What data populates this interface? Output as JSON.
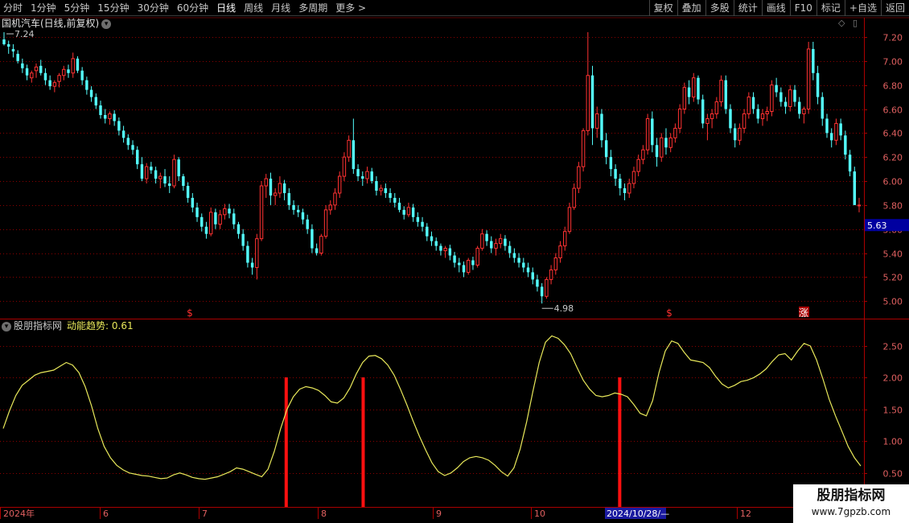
{
  "toolbar": {
    "periods": [
      "分时",
      "1分钟",
      "5分钟",
      "15分钟",
      "30分钟",
      "60分钟",
      "日线",
      "周线",
      "月线",
      "多周期",
      "更多 >"
    ],
    "active": "日线",
    "actions": [
      "复权",
      "叠加",
      "多股",
      "统计",
      "画线",
      "F10",
      "标记",
      "+自选",
      "返回"
    ]
  },
  "stock": {
    "title": "国机汽车(日线,前复权)",
    "high_label": "7.24",
    "low_label": "4.98",
    "last_price": "5.63"
  },
  "price_axis": [
    "7.20",
    "7.00",
    "6.80",
    "6.60",
    "6.40",
    "6.20",
    "6.00",
    "5.80",
    "5.60",
    "5.40",
    "5.20",
    "5.00"
  ],
  "indicator": {
    "name": "股朋指标网",
    "label": "动能趋势:",
    "value": "0.61"
  },
  "indicator_axis": [
    "2.50",
    "2.00",
    "1.50",
    "1.00",
    "0.50"
  ],
  "date_axis": [
    "2024年",
    "6",
    "7",
    "8",
    "9",
    "10",
    "2024/10/28/—",
    "12"
  ],
  "markers": [
    {
      "text": "$",
      "color": "#ff3030"
    },
    {
      "text": "$",
      "color": "#ff3030"
    },
    {
      "text": "涨",
      "color": "#ffffff"
    }
  ],
  "watermark": {
    "title": "股朋指标网",
    "url": "www.7gpzb.com"
  },
  "colors": {
    "up": "#ff3232",
    "down": "#54ffff",
    "line": "#e8e85a",
    "grid": "#8b0000",
    "signal": "#ff1010"
  },
  "chart_data": {
    "type": "candlestick",
    "candles": [
      [
        7.18,
        7.24,
        7.13,
        7.14
      ],
      [
        7.14,
        7.17,
        7.06,
        7.12
      ],
      [
        7.1,
        7.14,
        7.03,
        7.08
      ],
      [
        7.06,
        7.09,
        6.98,
        7.0
      ],
      [
        6.98,
        7.02,
        6.9,
        6.94
      ],
      [
        6.94,
        6.97,
        6.84,
        6.88
      ],
      [
        6.86,
        6.92,
        6.82,
        6.9
      ],
      [
        6.92,
        6.98,
        6.86,
        6.95
      ],
      [
        6.96,
        7.01,
        6.88,
        6.9
      ],
      [
        6.9,
        6.94,
        6.8,
        6.84
      ],
      [
        6.84,
        6.88,
        6.76,
        6.79
      ],
      [
        6.79,
        6.84,
        6.74,
        6.82
      ],
      [
        6.83,
        6.9,
        6.78,
        6.88
      ],
      [
        6.88,
        6.96,
        6.84,
        6.93
      ],
      [
        6.93,
        6.97,
        6.86,
        6.9
      ],
      [
        6.9,
        7.07,
        6.86,
        7.02
      ],
      [
        7.02,
        7.04,
        6.9,
        6.92
      ],
      [
        6.92,
        6.95,
        6.8,
        6.84
      ],
      [
        6.84,
        6.87,
        6.72,
        6.76
      ],
      [
        6.76,
        6.79,
        6.66,
        6.7
      ],
      [
        6.7,
        6.73,
        6.6,
        6.63
      ],
      [
        6.63,
        6.67,
        6.52,
        6.55
      ],
      [
        6.55,
        6.6,
        6.48,
        6.52
      ],
      [
        6.52,
        6.58,
        6.47,
        6.56
      ],
      [
        6.56,
        6.59,
        6.46,
        6.5
      ],
      [
        6.5,
        6.53,
        6.38,
        6.42
      ],
      [
        6.42,
        6.46,
        6.32,
        6.36
      ],
      [
        6.36,
        6.39,
        6.26,
        6.3
      ],
      [
        6.3,
        6.34,
        6.22,
        6.26
      ],
      [
        6.26,
        6.29,
        6.1,
        6.14
      ],
      [
        6.14,
        6.2,
        6.0,
        6.02
      ],
      [
        6.02,
        6.15,
        5.98,
        6.12
      ],
      [
        6.12,
        6.16,
        6.06,
        6.09
      ],
      [
        6.09,
        6.12,
        5.98,
        6.02
      ],
      [
        6.02,
        6.07,
        5.94,
        6.04
      ],
      [
        6.04,
        6.1,
        5.95,
        5.98
      ],
      [
        5.98,
        6.04,
        5.9,
        5.96
      ],
      [
        5.96,
        6.22,
        5.94,
        6.18
      ],
      [
        6.18,
        6.2,
        6.0,
        6.04
      ],
      [
        6.04,
        6.06,
        5.92,
        5.96
      ],
      [
        5.96,
        5.99,
        5.82,
        5.86
      ],
      [
        5.86,
        5.9,
        5.74,
        5.78
      ],
      [
        5.78,
        5.82,
        5.66,
        5.7
      ],
      [
        5.7,
        5.73,
        5.58,
        5.62
      ],
      [
        5.62,
        5.66,
        5.52,
        5.56
      ],
      [
        5.56,
        5.78,
        5.54,
        5.74
      ],
      [
        5.74,
        5.77,
        5.6,
        5.64
      ],
      [
        5.64,
        5.76,
        5.6,
        5.72
      ],
      [
        5.72,
        5.81,
        5.68,
        5.77
      ],
      [
        5.77,
        5.81,
        5.69,
        5.73
      ],
      [
        5.73,
        5.77,
        5.6,
        5.64
      ],
      [
        5.64,
        5.66,
        5.52,
        5.56
      ],
      [
        5.56,
        5.6,
        5.42,
        5.46
      ],
      [
        5.46,
        5.5,
        5.28,
        5.32
      ],
      [
        5.32,
        5.36,
        5.22,
        5.28
      ],
      [
        5.28,
        5.56,
        5.18,
        5.52
      ],
      [
        5.52,
        6.0,
        5.5,
        5.96
      ],
      [
        5.96,
        6.06,
        5.86,
        6.02
      ],
      [
        6.02,
        6.07,
        5.8,
        5.88
      ],
      [
        5.88,
        5.94,
        5.8,
        5.9
      ],
      [
        5.9,
        6.04,
        5.86,
        5.98
      ],
      [
        5.98,
        6.01,
        5.84,
        5.9
      ],
      [
        5.9,
        5.94,
        5.76,
        5.8
      ],
      [
        5.8,
        5.84,
        5.72,
        5.76
      ],
      [
        5.76,
        5.8,
        5.7,
        5.74
      ],
      [
        5.74,
        5.77,
        5.64,
        5.68
      ],
      [
        5.68,
        5.72,
        5.56,
        5.6
      ],
      [
        5.6,
        5.64,
        5.4,
        5.44
      ],
      [
        5.44,
        5.48,
        5.38,
        5.4
      ],
      [
        5.4,
        5.56,
        5.38,
        5.54
      ],
      [
        5.54,
        5.8,
        5.52,
        5.76
      ],
      [
        5.76,
        5.84,
        5.72,
        5.8
      ],
      [
        5.8,
        5.94,
        5.76,
        5.9
      ],
      [
        5.9,
        6.08,
        5.86,
        6.04
      ],
      [
        6.04,
        6.24,
        6.0,
        6.2
      ],
      [
        6.2,
        6.38,
        6.16,
        6.34
      ],
      [
        6.34,
        6.52,
        6.06,
        6.1
      ],
      [
        6.1,
        6.14,
        6.0,
        6.04
      ],
      [
        6.04,
        6.08,
        5.96,
        6.02
      ],
      [
        6.02,
        6.12,
        5.98,
        6.08
      ],
      [
        6.08,
        6.11,
        5.98,
        6.0
      ],
      [
        6.0,
        6.04,
        5.88,
        5.92
      ],
      [
        5.92,
        5.97,
        5.88,
        5.94
      ],
      [
        5.94,
        5.98,
        5.86,
        5.9
      ],
      [
        5.9,
        5.94,
        5.82,
        5.86
      ],
      [
        5.86,
        5.9,
        5.78,
        5.82
      ],
      [
        5.82,
        5.86,
        5.74,
        5.76
      ],
      [
        5.76,
        5.79,
        5.68,
        5.72
      ],
      [
        5.72,
        5.82,
        5.7,
        5.78
      ],
      [
        5.78,
        5.81,
        5.66,
        5.7
      ],
      [
        5.7,
        5.74,
        5.62,
        5.66
      ],
      [
        5.66,
        5.7,
        5.58,
        5.62
      ],
      [
        5.62,
        5.65,
        5.5,
        5.54
      ],
      [
        5.54,
        5.58,
        5.46,
        5.5
      ],
      [
        5.5,
        5.53,
        5.42,
        5.46
      ],
      [
        5.46,
        5.48,
        5.38,
        5.42
      ],
      [
        5.42,
        5.46,
        5.36,
        5.44
      ],
      [
        5.44,
        5.47,
        5.34,
        5.38
      ],
      [
        5.38,
        5.41,
        5.28,
        5.32
      ],
      [
        5.32,
        5.36,
        5.24,
        5.3
      ],
      [
        5.3,
        5.33,
        5.2,
        5.24
      ],
      [
        5.24,
        5.36,
        5.22,
        5.34
      ],
      [
        5.34,
        5.37,
        5.26,
        5.3
      ],
      [
        5.3,
        5.46,
        5.28,
        5.44
      ],
      [
        5.44,
        5.6,
        5.42,
        5.56
      ],
      [
        5.56,
        5.59,
        5.46,
        5.5
      ],
      [
        5.5,
        5.54,
        5.4,
        5.44
      ],
      [
        5.44,
        5.52,
        5.38,
        5.48
      ],
      [
        5.48,
        5.56,
        5.44,
        5.52
      ],
      [
        5.52,
        5.55,
        5.42,
        5.46
      ],
      [
        5.46,
        5.5,
        5.36,
        5.4
      ],
      [
        5.4,
        5.44,
        5.32,
        5.36
      ],
      [
        5.36,
        5.4,
        5.28,
        5.32
      ],
      [
        5.32,
        5.36,
        5.24,
        5.28
      ],
      [
        5.28,
        5.32,
        5.2,
        5.24
      ],
      [
        5.24,
        5.28,
        5.14,
        5.18
      ],
      [
        5.18,
        5.22,
        5.08,
        5.12
      ],
      [
        5.12,
        5.15,
        4.98,
        5.04
      ],
      [
        5.04,
        5.2,
        5.02,
        5.18
      ],
      [
        5.18,
        5.3,
        5.14,
        5.26
      ],
      [
        5.26,
        5.4,
        5.22,
        5.36
      ],
      [
        5.36,
        5.5,
        5.32,
        5.46
      ],
      [
        5.46,
        5.62,
        5.42,
        5.58
      ],
      [
        5.58,
        5.82,
        5.56,
        5.78
      ],
      [
        5.78,
        5.98,
        5.76,
        5.94
      ],
      [
        5.94,
        6.16,
        5.9,
        6.12
      ],
      [
        6.12,
        6.44,
        6.08,
        6.42
      ],
      [
        6.42,
        7.24,
        6.38,
        6.88
      ],
      [
        6.88,
        6.96,
        6.3,
        6.44
      ],
      [
        6.44,
        6.62,
        6.36,
        6.56
      ],
      [
        6.56,
        6.6,
        6.28,
        6.34
      ],
      [
        6.34,
        6.4,
        6.14,
        6.2
      ],
      [
        6.2,
        6.26,
        6.04,
        6.1
      ],
      [
        6.1,
        6.14,
        5.96,
        6.02
      ],
      [
        6.02,
        6.06,
        5.88,
        5.94
      ],
      [
        5.94,
        5.98,
        5.84,
        5.9
      ],
      [
        5.9,
        6.02,
        5.86,
        5.98
      ],
      [
        5.98,
        6.12,
        5.94,
        6.08
      ],
      [
        6.08,
        6.22,
        6.04,
        6.18
      ],
      [
        6.18,
        6.3,
        6.14,
        6.26
      ],
      [
        6.26,
        6.56,
        6.22,
        6.52
      ],
      [
        6.52,
        6.58,
        6.24,
        6.3
      ],
      [
        6.3,
        6.36,
        6.12,
        6.2
      ],
      [
        6.2,
        6.4,
        6.16,
        6.36
      ],
      [
        6.36,
        6.44,
        6.22,
        6.28
      ],
      [
        6.28,
        6.4,
        6.24,
        6.36
      ],
      [
        6.36,
        6.48,
        6.32,
        6.44
      ],
      [
        6.44,
        6.64,
        6.4,
        6.6
      ],
      [
        6.6,
        6.82,
        6.56,
        6.78
      ],
      [
        6.78,
        6.84,
        6.64,
        6.7
      ],
      [
        6.7,
        6.9,
        6.66,
        6.86
      ],
      [
        6.86,
        6.88,
        6.64,
        6.68
      ],
      [
        6.68,
        6.72,
        6.44,
        6.48
      ],
      [
        6.48,
        6.56,
        6.34,
        6.52
      ],
      [
        6.52,
        6.6,
        6.44,
        6.56
      ],
      [
        6.56,
        6.7,
        6.52,
        6.66
      ],
      [
        6.66,
        6.88,
        6.62,
        6.84
      ],
      [
        6.84,
        6.88,
        6.56,
        6.6
      ],
      [
        6.6,
        6.64,
        6.4,
        6.44
      ],
      [
        6.44,
        6.48,
        6.28,
        6.34
      ],
      [
        6.34,
        6.48,
        6.3,
        6.44
      ],
      [
        6.44,
        6.6,
        6.4,
        6.56
      ],
      [
        6.56,
        6.74,
        6.52,
        6.7
      ],
      [
        6.7,
        6.74,
        6.56,
        6.6
      ],
      [
        6.6,
        6.64,
        6.48,
        6.52
      ],
      [
        6.52,
        6.6,
        6.46,
        6.56
      ],
      [
        6.56,
        6.62,
        6.5,
        6.58
      ],
      [
        6.58,
        6.84,
        6.54,
        6.8
      ],
      [
        6.8,
        6.86,
        6.7,
        6.74
      ],
      [
        6.74,
        6.78,
        6.62,
        6.66
      ],
      [
        6.66,
        6.7,
        6.56,
        6.62
      ],
      [
        6.62,
        6.8,
        6.58,
        6.76
      ],
      [
        6.76,
        6.8,
        6.62,
        6.66
      ],
      [
        6.66,
        6.7,
        6.52,
        6.56
      ],
      [
        6.56,
        6.62,
        6.48,
        6.6
      ],
      [
        6.6,
        7.16,
        6.56,
        7.1
      ],
      [
        7.1,
        7.16,
        6.84,
        6.9
      ],
      [
        6.9,
        6.96,
        6.64,
        6.7
      ],
      [
        6.7,
        6.74,
        6.46,
        6.52
      ],
      [
        6.52,
        6.56,
        6.36,
        6.4
      ],
      [
        6.4,
        6.44,
        6.28,
        6.34
      ],
      [
        6.34,
        6.52,
        6.3,
        6.48
      ],
      [
        6.48,
        6.52,
        6.34,
        6.38
      ],
      [
        6.38,
        6.42,
        6.18,
        6.22
      ],
      [
        6.22,
        6.26,
        6.04,
        6.08
      ],
      [
        6.08,
        6.12,
        5.84,
        5.8
      ],
      [
        5.8,
        5.86,
        5.74,
        5.8
      ]
    ],
    "indicator": [
      1.2,
      1.48,
      1.72,
      1.88,
      1.96,
      2.04,
      2.08,
      2.1,
      2.12,
      2.18,
      2.24,
      2.2,
      2.08,
      1.86,
      1.56,
      1.2,
      0.92,
      0.74,
      0.62,
      0.55,
      0.5,
      0.48,
      0.46,
      0.45,
      0.43,
      0.41,
      0.42,
      0.47,
      0.5,
      0.47,
      0.43,
      0.41,
      0.4,
      0.42,
      0.44,
      0.48,
      0.52,
      0.58,
      0.56,
      0.52,
      0.48,
      0.44,
      0.56,
      0.84,
      1.2,
      1.5,
      1.7,
      1.82,
      1.86,
      1.84,
      1.8,
      1.72,
      1.62,
      1.6,
      1.68,
      1.84,
      2.06,
      2.24,
      2.34,
      2.35,
      2.3,
      2.2,
      2.04,
      1.82,
      1.58,
      1.32,
      1.08,
      0.86,
      0.66,
      0.52,
      0.46,
      0.5,
      0.58,
      0.68,
      0.74,
      0.76,
      0.74,
      0.7,
      0.62,
      0.52,
      0.45,
      0.58,
      0.88,
      1.3,
      1.78,
      2.24,
      2.56,
      2.66,
      2.62,
      2.52,
      2.38,
      2.16,
      1.96,
      1.82,
      1.72,
      1.7,
      1.72,
      1.76,
      1.74,
      1.7,
      1.58,
      1.44,
      1.4,
      1.64,
      2.08,
      2.42,
      2.58,
      2.54,
      2.4,
      2.28,
      2.26,
      2.24,
      2.16,
      2.02,
      1.9,
      1.84,
      1.88,
      1.94,
      1.96,
      2.0,
      2.06,
      2.14,
      2.26,
      2.36,
      2.38,
      2.28,
      2.42,
      2.54,
      2.5,
      2.28,
      1.98,
      1.66,
      1.4,
      1.16,
      0.92,
      0.74,
      0.61
    ],
    "signals": [
      0.33,
      0.42,
      0.72
    ]
  }
}
